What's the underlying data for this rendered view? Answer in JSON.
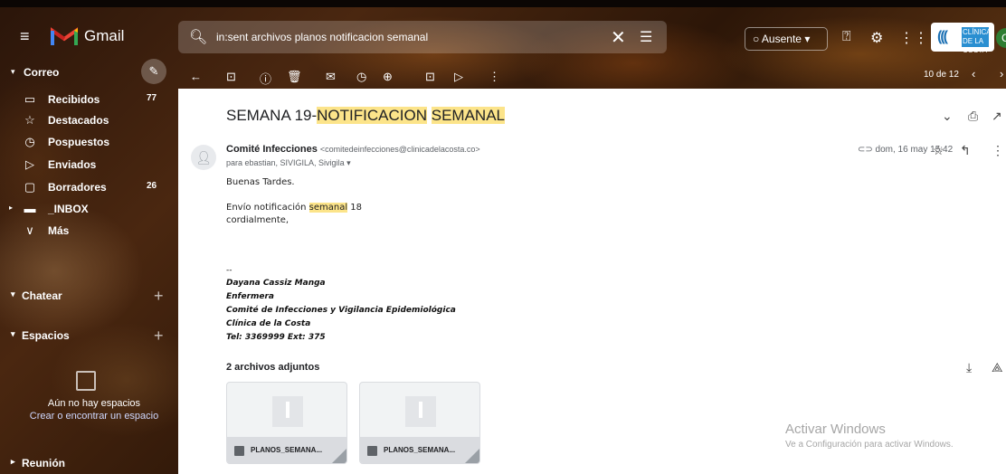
{
  "header": {
    "app_name": "Gmail",
    "search_value": "in:sent archivos planos notificacion semanal",
    "status_label": "Ausente",
    "brand_text": "CLÍNICA DE LA COSTA",
    "avatar_initial": "C"
  },
  "sidebar": {
    "section_mail": "Correo",
    "items": [
      {
        "label": "Recibidos",
        "count": "77",
        "icon": "inbox-icon"
      },
      {
        "label": "Destacados",
        "count": "",
        "icon": "star-icon"
      },
      {
        "label": "Pospuestos",
        "count": "",
        "icon": "clock-icon"
      },
      {
        "label": "Enviados",
        "count": "",
        "icon": "send-icon"
      },
      {
        "label": "Borradores",
        "count": "26",
        "icon": "draft-icon"
      },
      {
        "label": "_INBOX",
        "count": "",
        "icon": "label-icon"
      },
      {
        "label": "Más",
        "count": "",
        "icon": "chevron-down-icon"
      }
    ],
    "section_chat": "Chatear",
    "section_spaces": "Espacios",
    "spaces_empty_line1": "Aún no hay espacios",
    "spaces_empty_line2": "Crear o encontrar un espacio",
    "section_meeting": "Reunión"
  },
  "toolbar": {
    "page_info": "10 de 12"
  },
  "email": {
    "subject_prefix": "SEMANA 19-",
    "subject_hl1": "NOTIFICACION",
    "subject_space": " ",
    "subject_hl2": "SEMANAL",
    "sender_name": "Comité Infecciones",
    "sender_email": "<comitedeinfecciones@clinicadelacosta.co>",
    "to_line": "para ebastian, SIVIGILA, Sivigila",
    "date": "dom, 16 may 15:42",
    "greeting": "Buenas Tardes.",
    "line1_pre": "Envío notificación ",
    "line1_hl": "semanal",
    "line1_post": " 18",
    "line2": "cordialmente,",
    "sig_dash": "--",
    "sig_name": "Dayana Cassiz Manga",
    "sig_role": "Enfermera",
    "sig_dept": "Comité de Infecciones y Vigilancia Epidemiológica",
    "sig_org": "Clínica de la Costa",
    "sig_tel": "Tel: 3369999 Ext: 375",
    "attachments_title": "2 archivos adjuntos",
    "attachments": [
      {
        "name": "PLANOS_SEMANA..."
      },
      {
        "name": "PLANOS_SEMANA..."
      }
    ]
  },
  "watermark": {
    "line1": "Activar Windows",
    "line2": "Ve a Configuración para activar Windows."
  }
}
